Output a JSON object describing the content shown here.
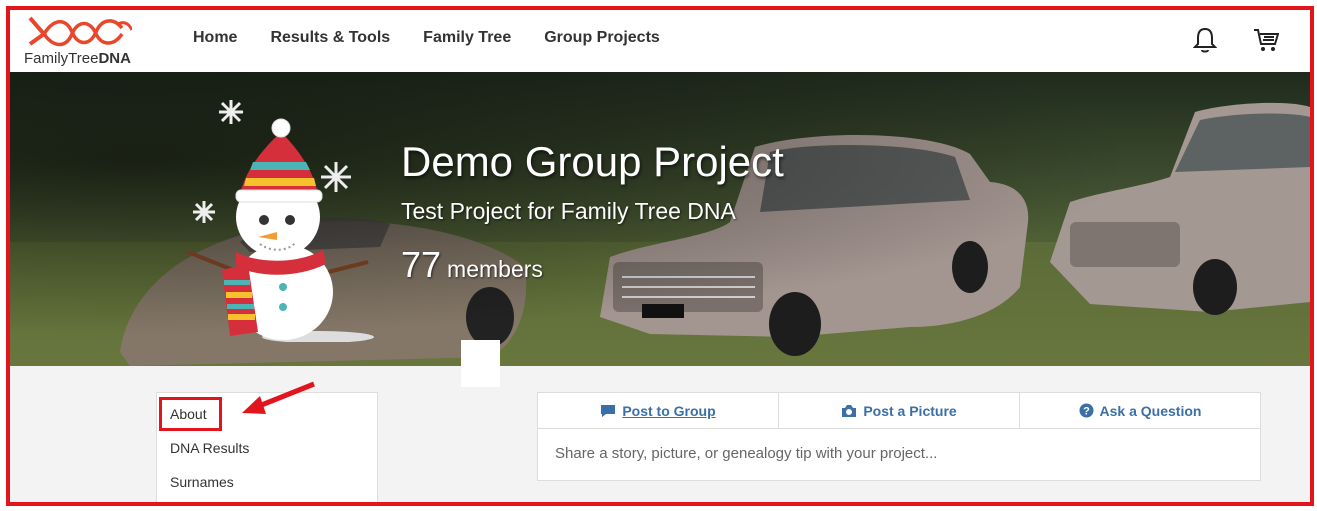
{
  "logo": {
    "text_regular": "FamilyTree",
    "text_bold": "DNA"
  },
  "nav": [
    {
      "label": "Home"
    },
    {
      "label": "Results & Tools"
    },
    {
      "label": "Family Tree"
    },
    {
      "label": "Group Projects"
    }
  ],
  "header_icons": {
    "notifications": "bell-icon",
    "cart": "cart-icon"
  },
  "banner": {
    "title": "Demo Group Project",
    "subtitle": "Test Project for Family Tree DNA",
    "member_count": "77",
    "member_label": "members"
  },
  "sidemenu": {
    "items": [
      {
        "label": "About"
      },
      {
        "label": "DNA Results"
      },
      {
        "label": "Surnames"
      }
    ]
  },
  "post_panel": {
    "tabs": [
      {
        "label": "Post to Group",
        "icon": "comment-icon"
      },
      {
        "label": "Post a Picture",
        "icon": "camera-icon"
      },
      {
        "label": "Ask a Question",
        "icon": "question-icon"
      }
    ],
    "placeholder": "Share a story, picture, or genealogy tip with your project..."
  },
  "colors": {
    "accent": "#3b6fa8",
    "highlight": "#e3141b",
    "logo": "#e8472b"
  }
}
